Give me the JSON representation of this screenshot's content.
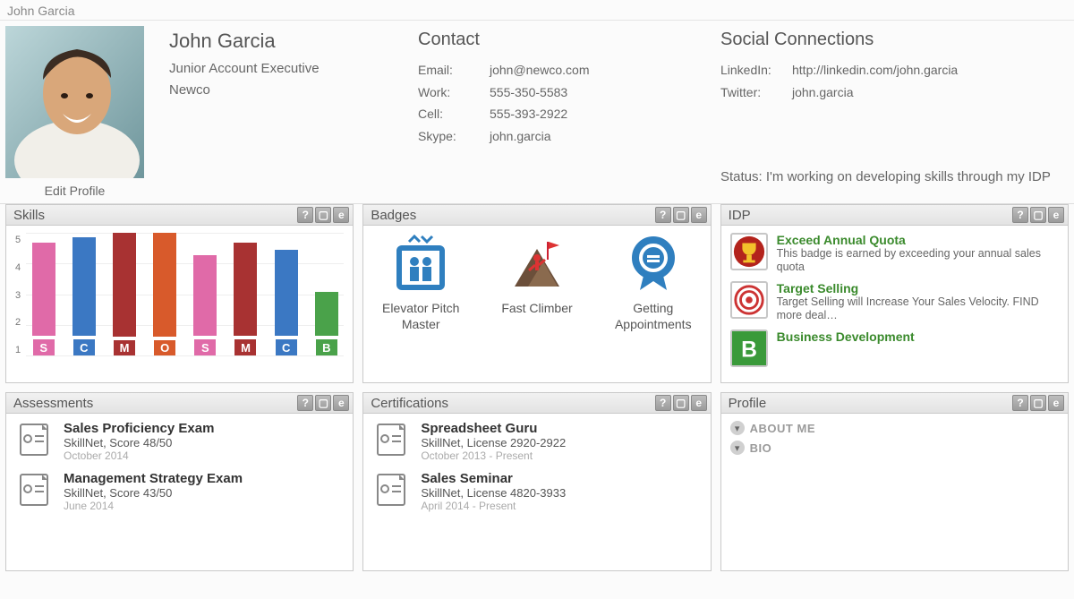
{
  "page_title": "John Garcia",
  "edit_profile_label": "Edit Profile",
  "person": {
    "name": "John Garcia",
    "title": "Junior Account Executive",
    "company": "Newco"
  },
  "contact": {
    "heading": "Contact",
    "rows": [
      {
        "k": "Email:",
        "v": "john@newco.com"
      },
      {
        "k": "Work:",
        "v": "555-350-5583"
      },
      {
        "k": "Cell:",
        "v": "555-393-2922"
      },
      {
        "k": "Skype:",
        "v": "john.garcia"
      }
    ]
  },
  "social": {
    "heading": "Social Connections",
    "rows": [
      {
        "k": "LinkedIn:",
        "v": "http://linkedin.com/john.garcia"
      },
      {
        "k": "Twitter:",
        "v": "john.garcia"
      }
    ]
  },
  "status": {
    "label": "Status:",
    "text": "I'm working on developing skills through my IDP"
  },
  "panels": {
    "skills": {
      "title": "Skills"
    },
    "badges": {
      "title": "Badges"
    },
    "idp": {
      "title": "IDP"
    },
    "assess": {
      "title": "Assessments"
    },
    "certs": {
      "title": "Certifications"
    },
    "profile": {
      "title": "Profile"
    }
  },
  "panel_icon_labels": {
    "help": "?",
    "minimize": "▢",
    "expand": "e"
  },
  "chart_data": {
    "type": "bar",
    "ylim": [
      0,
      5
    ],
    "yticks": [
      5,
      4,
      3,
      2,
      1
    ],
    "bars": [
      {
        "label": "S",
        "value": 3.8,
        "color": "#e06aa8"
      },
      {
        "label": "C",
        "value": 4.0,
        "color": "#3b78c3"
      },
      {
        "label": "M",
        "value": 4.6,
        "color": "#a83232"
      },
      {
        "label": "O",
        "value": 4.5,
        "color": "#d85a2b"
      },
      {
        "label": "S",
        "value": 3.3,
        "color": "#e06aa8"
      },
      {
        "label": "M",
        "value": 3.8,
        "color": "#a83232"
      },
      {
        "label": "C",
        "value": 3.5,
        "color": "#3b78c3"
      },
      {
        "label": "B",
        "value": 1.8,
        "color": "#4aa24a"
      }
    ]
  },
  "badges": [
    {
      "name": "Elevator Pitch Master",
      "icon": "elevator"
    },
    {
      "name": "Fast Climber",
      "icon": "climber"
    },
    {
      "name": "Getting Appointments",
      "icon": "ribbon"
    }
  ],
  "idp": [
    {
      "title": "Exceed Annual Quota",
      "desc": "This badge is earned by exceeding your annual sales quota",
      "icon": "trophy"
    },
    {
      "title": "Target Selling",
      "desc": "Target Selling will Increase Your Sales Velocity. FIND more deal…",
      "icon": "target"
    },
    {
      "title": "Business Development",
      "desc": "",
      "icon": "letter-b"
    }
  ],
  "assessments": [
    {
      "title": "Sales Proficiency Exam",
      "sub": "SkillNet, Score 48/50",
      "date": "October 2014"
    },
    {
      "title": "Management Strategy Exam",
      "sub": "SkillNet, Score 43/50",
      "date": "June 2014"
    }
  ],
  "certifications": [
    {
      "title": "Spreadsheet Guru",
      "sub": "SkillNet, License 2920-2922",
      "date": "October 2013 - Present"
    },
    {
      "title": "Sales Seminar",
      "sub": "SkillNet, License 4820-3933",
      "date": "April 2014 - Present"
    }
  ],
  "profile_sections": [
    {
      "label": "ABOUT ME"
    },
    {
      "label": "BIO"
    }
  ]
}
